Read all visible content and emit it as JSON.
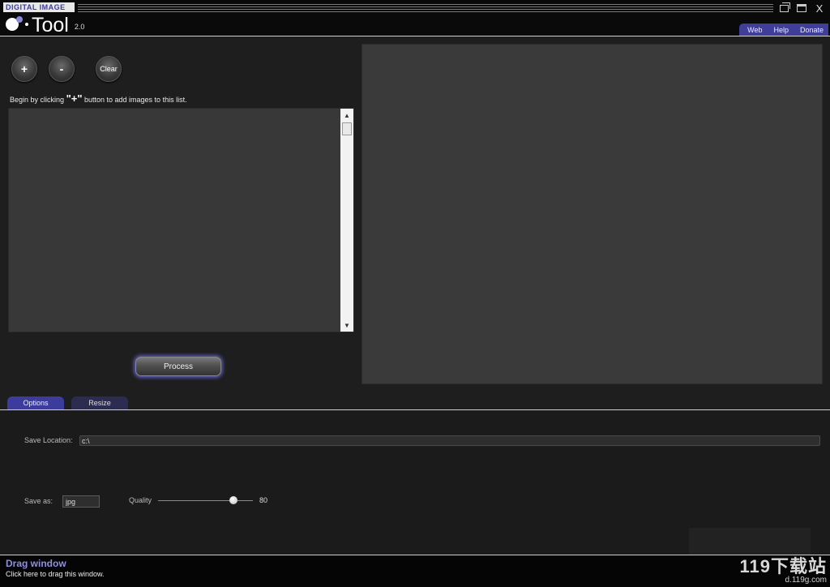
{
  "app": {
    "brand_top": "DIGITAL IMAGE",
    "name": "Tool",
    "version": "2.0"
  },
  "window_controls": {
    "restore_icon": "restore-icon",
    "maximize_icon": "maximize-icon",
    "close_label": "X"
  },
  "top_links": [
    "Web",
    "Help",
    "Donate"
  ],
  "list_controls": {
    "add_label": "+",
    "remove_label": "-",
    "clear_label": "Clear"
  },
  "hint": {
    "before": "Begin by clicking",
    "highlight": "\"+\"",
    "after": "button  to add images to this list."
  },
  "process_label": "Process",
  "tabs": [
    {
      "label": "Options",
      "active": true
    },
    {
      "label": "Resize",
      "active": false
    }
  ],
  "options": {
    "save_location_label": "Save Location:",
    "save_location_value": "c:\\",
    "save_as_label": "Save as:",
    "save_as_value": "jpg",
    "quality_label": "Quality",
    "quality_value": "80",
    "quality_fraction": 0.8
  },
  "footer": {
    "drag_title": "Drag window",
    "drag_subtitle": "Click here to drag this window."
  },
  "watermark": {
    "main": "119下载站",
    "sub": "d.119g.com"
  },
  "colors": {
    "accent": "#3c3c9c",
    "drag_title": "#8f8fe0",
    "background": "#1e1e1e"
  }
}
